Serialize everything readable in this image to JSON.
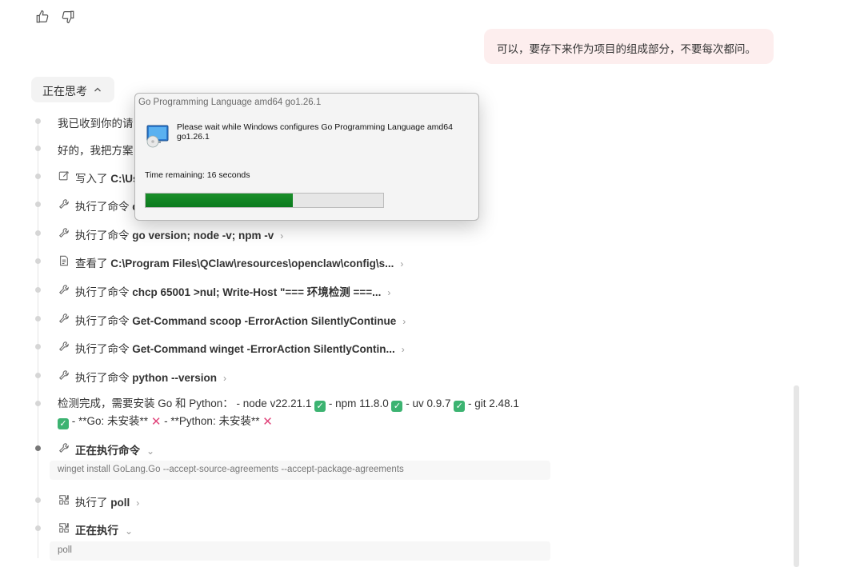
{
  "feedback": {
    "like_icon": "thumbs-up-icon",
    "dislike_icon": "thumbs-down-icon"
  },
  "user_message": "可以，要存下来作为项目的组成部分，不要每次都问。",
  "thinking": {
    "label": "正在思考"
  },
  "steps": [
    {
      "icon": "none",
      "text": "我已收到你的请"
    },
    {
      "icon": "none",
      "text": "好的，我把方案"
    },
    {
      "icon": "edit-icon",
      "prefix": "写入了",
      "target": "C:\\Us"
    },
    {
      "icon": "wrench-icon",
      "prefix": "执行了命令",
      "target": "c"
    },
    {
      "icon": "wrench-icon",
      "prefix": "执行了命令",
      "target": "go version; node -v; npm -v"
    },
    {
      "icon": "file-icon",
      "prefix": "查看了",
      "target": "C:\\Program Files\\QClaw\\resources\\openclaw\\config\\s..."
    },
    {
      "icon": "wrench-icon",
      "prefix": "执行了命令",
      "target": "chcp 65001 >nul; Write-Host \"=== 环境检测 ===..."
    },
    {
      "icon": "wrench-icon",
      "prefix": "执行了命令",
      "target": "Get-Command scoop -ErrorAction SilentlyContinue"
    },
    {
      "icon": "wrench-icon",
      "prefix": "执行了命令",
      "target": "Get-Command winget -ErrorAction SilentlyContin..."
    },
    {
      "icon": "wrench-icon",
      "prefix": "执行了命令",
      "target": "python --version"
    }
  ],
  "detection": {
    "line1": "检测完成，需要安装 Go 和 Python：  - node v22.21.1",
    "npm": "- npm 11.8.0",
    "uv": "- uv 0.9.7",
    "git": "- git 2.48.1",
    "go": "- **Go: 未安装**",
    "python": "- **Python: 未安装**"
  },
  "running_cmd": {
    "label": "正在执行命令",
    "command": "winget install GoLang.Go --accept-source-agreements --accept-package-agreements"
  },
  "poll_done": {
    "prefix": "执行了",
    "target": "poll"
  },
  "running": {
    "label": "正在执行",
    "command": "poll"
  },
  "dialog": {
    "title": "Go Programming Language amd64 go1.26.1",
    "message": "Please wait while Windows configures Go Programming Language amd64 go1.26.1",
    "time_remaining": "Time remaining: 16 seconds",
    "progress": 0.62,
    "progress_color": "#0b7a1d"
  }
}
